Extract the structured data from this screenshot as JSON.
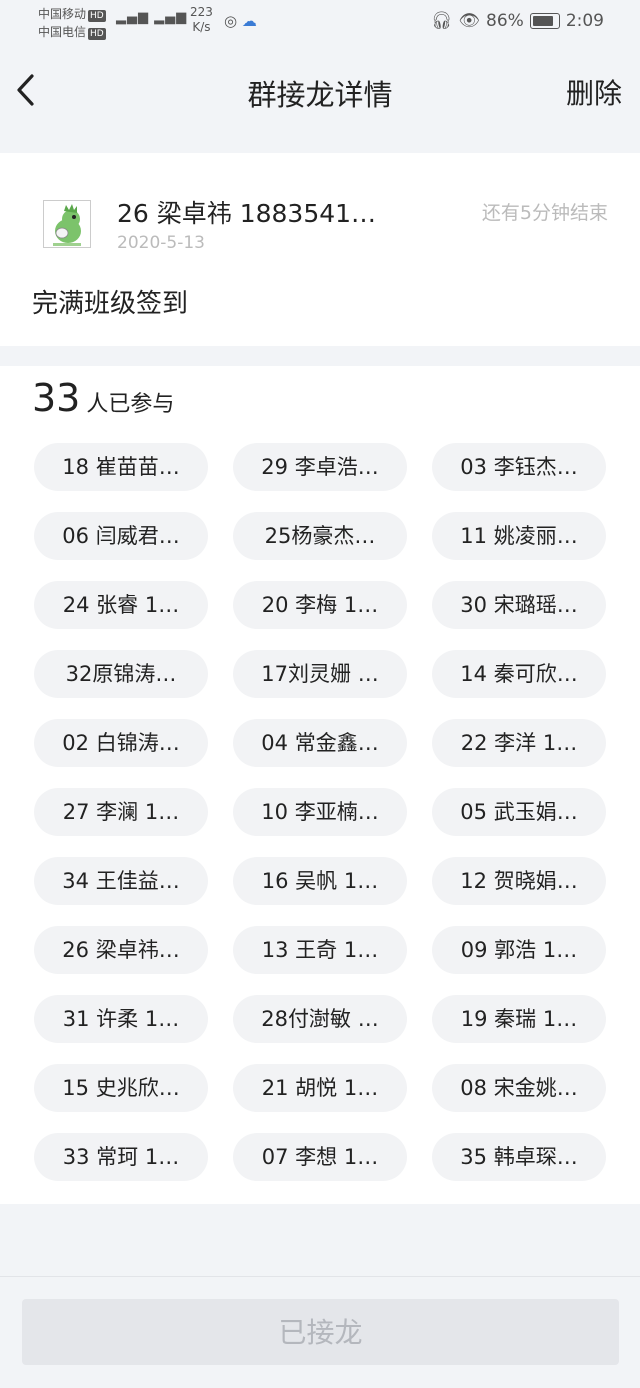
{
  "status_bar": {
    "carrier_1": "中国移动",
    "carrier_2": "中国电信",
    "hd": "HD",
    "speed_value": "223",
    "speed_unit": "K/s",
    "battery": "86%",
    "time": "2:09"
  },
  "nav": {
    "title": "群接龙详情",
    "delete_label": "删除"
  },
  "post": {
    "author": "26 梁卓祎 1883541…",
    "date": "2020-5-13",
    "remaining": "还有5分钟结束",
    "title": "完满班级签到"
  },
  "participants": {
    "count": "33",
    "count_label": "人已参与",
    "names": [
      "18 崔苗苗…",
      "29 李卓浩…",
      "03 李钰杰…",
      "06 闫威君…",
      "25杨豪杰…",
      "11 姚凌丽…",
      "24 张睿 1…",
      "20 李梅 1…",
      "30 宋璐瑶…",
      "32原锦涛…",
      "17刘灵姗 …",
      "14 秦可欣…",
      "02 白锦涛…",
      "04 常金鑫…",
      "22 李洋 1…",
      "27 李澜 1…",
      "10 李亚楠…",
      "05 武玉娟…",
      "34 王佳益…",
      "16 吴帆 1…",
      "12 贺晓娟…",
      "26 梁卓祎…",
      "13 王奇 1…",
      "09 郭浩 1…",
      "31 许柔 1…",
      "28付澍敏 …",
      "19 秦瑞 1…",
      "15 史兆欣…",
      "21 胡悦 1…",
      "08 宋金姚…",
      "33 常珂 1…",
      "07 李想 1…",
      "35 韩卓琛…"
    ]
  },
  "footer": {
    "joined_label": "已接龙"
  }
}
